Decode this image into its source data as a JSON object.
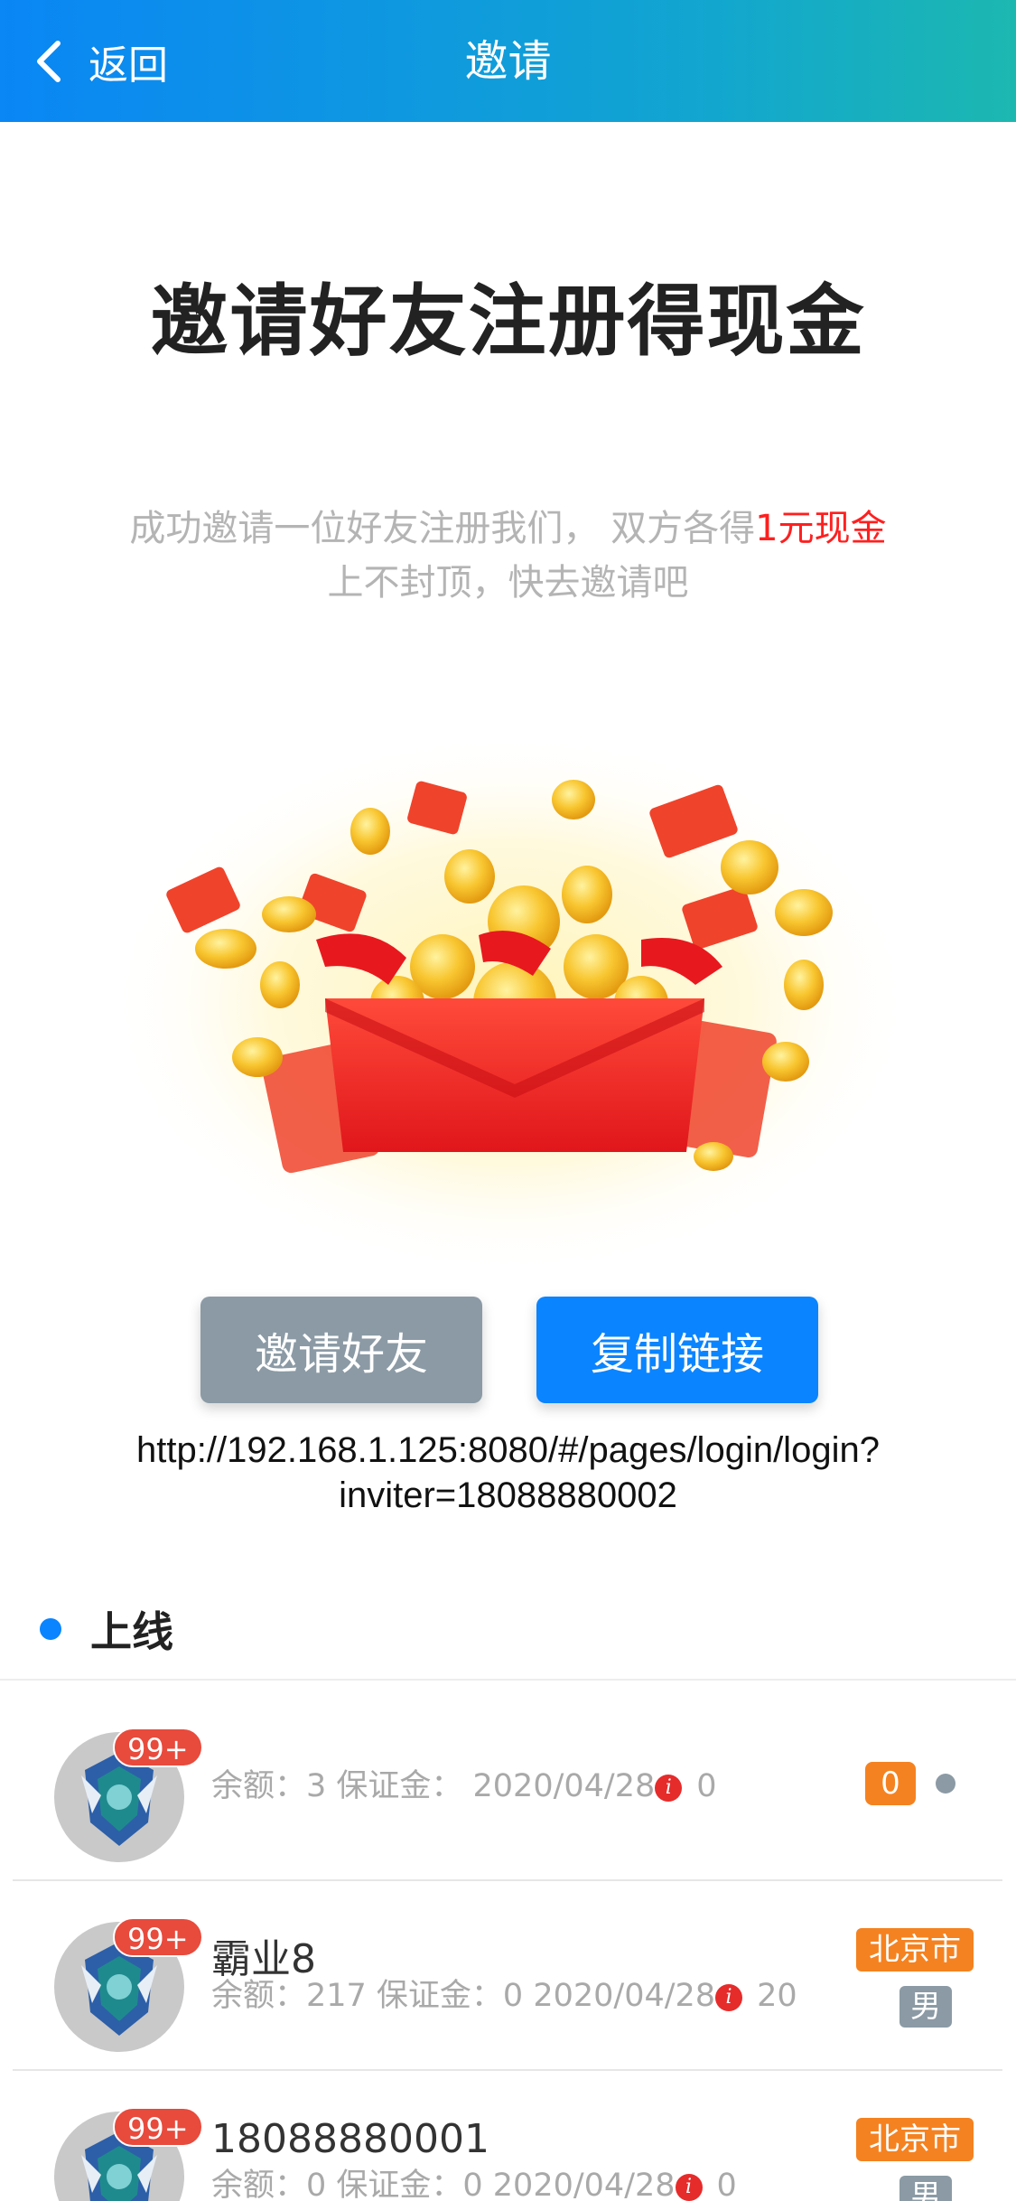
{
  "nav": {
    "back_label": "返回",
    "title": "邀请"
  },
  "hero": {
    "title": "邀请好友注册得现金",
    "desc_prefix": "成功邀请一位好友注册我们， 双方各得",
    "desc_highlight": "1元现金",
    "desc_line2": "上不封顶，快去邀请吧"
  },
  "actions": {
    "invite_label": "邀请好友",
    "copy_label": "复制链接"
  },
  "invite_link": {
    "line1": "http://192.168.1.125:8080/#/pages/login/login?",
    "line2": "inviter=18088880002"
  },
  "section": {
    "label": "上线"
  },
  "rows": [
    {
      "badge": "99+",
      "name": "",
      "meta": "余额：3 保证金： 2020/04/28",
      "count": "0",
      "tag_count": "0"
    },
    {
      "badge": "99+",
      "name": "霸业8",
      "meta": "余额：217 保证金：0 2020/04/28",
      "count": "20",
      "city": "北京市",
      "gender": "男"
    },
    {
      "badge": "99+",
      "name": "18088880001",
      "meta": "余额：0 保证金：0 2020/04/28",
      "count": "0",
      "city": "北京市",
      "gender": "男"
    }
  ],
  "icons": {
    "back": "chevron-left-icon",
    "info": "info-icon",
    "illustration": "red-envelope-coins-illustration"
  },
  "colors": {
    "nav_start": "#0a86f5",
    "nav_end": "#1cb8b0",
    "primary": "#0a84ff",
    "gray_button": "#8b9aa5",
    "highlight_red": "#ff1f1f",
    "badge_red": "#e84a3c",
    "tag_orange": "#f58220"
  }
}
